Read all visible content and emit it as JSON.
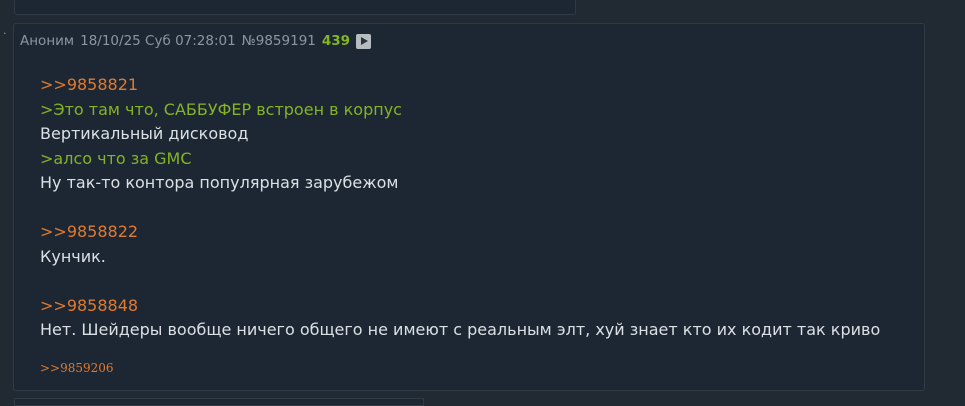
{
  "post": {
    "author": "Аноним",
    "date": "18/10/25 Суб 07:28:01",
    "number": "№9859191",
    "reply_count": "439",
    "blocks": [
      {
        "reply": ">>9858821"
      },
      {
        "quote": ">Это там что, САББУФЕР встроен в корпус"
      },
      {
        "text": "Вертикальный дисковод"
      },
      {
        "quote": ">алсо что за GMC"
      },
      {
        "text": "Ну так-то контора популярная зарубежом"
      },
      {
        "reply": ">>9858822"
      },
      {
        "text": "Кунчик."
      },
      {
        "reply": ">>9858848"
      },
      {
        "text": "Нет. Шейдеры вообще ничего общего не имеют с реальным элт, хуй знает кто их кодит так криво"
      }
    ],
    "backlink": ">>9859206"
  },
  "colors": {
    "background": "#212a33",
    "post_background": "#1c2733",
    "reply_link": "#e07a2f",
    "quote": "#84b325",
    "text": "#dbe0e4",
    "meta": "#8a96a0"
  }
}
